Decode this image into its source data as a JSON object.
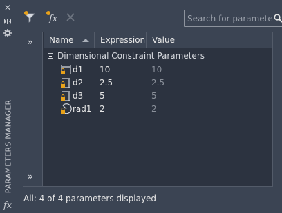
{
  "side_panel": {
    "title": "PARAMETERS MANAGER",
    "icons": [
      "close-icon",
      "auto-hide-icon",
      "properties-icon",
      "fx-icon"
    ]
  },
  "toolbar": {
    "buttons": [
      "filter-icon",
      "new-user-parameter-icon",
      "delete-icon"
    ],
    "search_placeholder": "Search for parameter"
  },
  "grid": {
    "columns": [
      "Name",
      "Expression",
      "Value"
    ],
    "sorted_by": "Name",
    "group_label": "Dimensional Constraint Parameters",
    "rows": [
      {
        "name": "d1",
        "expression": "10",
        "value": "10",
        "icon": "linear-dimension-icon"
      },
      {
        "name": "d2",
        "expression": "2.5",
        "value": "2.5",
        "icon": "aligned-dimension-icon"
      },
      {
        "name": "d3",
        "expression": "5",
        "value": "5",
        "icon": "aligned-dimension-icon"
      },
      {
        "name": "rad1",
        "expression": "2",
        "value": "2",
        "icon": "radius-icon"
      }
    ]
  },
  "status": "All: 4 of 4 parameters displayed",
  "colors": {
    "background": "#3b4453",
    "grid_background": "#2c3340",
    "lock_icon": "#e8a21a",
    "value_text": "#8a909a"
  }
}
